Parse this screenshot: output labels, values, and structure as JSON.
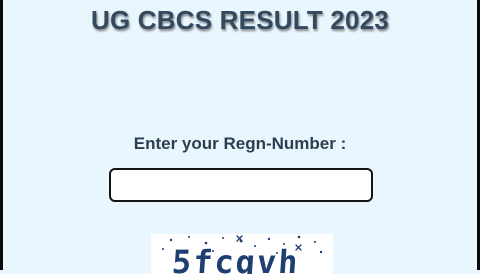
{
  "page": {
    "title": "UG CBCS RESULT 2023"
  },
  "form": {
    "regn_label": "Enter your Regn-Number :",
    "regn_value": ""
  },
  "captcha": {
    "text": "5fcqvh"
  },
  "colors": {
    "background": "#eaf6fd",
    "title": "#34495e",
    "label": "#2c3e50",
    "captcha_text": "#1f3f73"
  }
}
